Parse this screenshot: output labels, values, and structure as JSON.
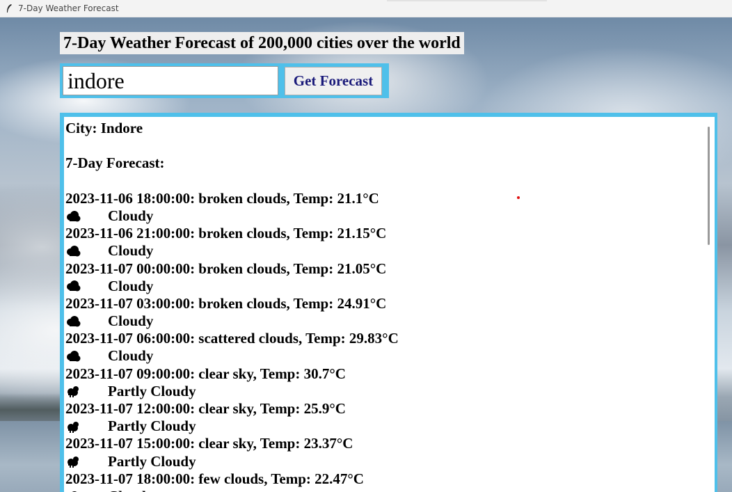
{
  "window": {
    "title": "7-Day Weather Forecast"
  },
  "heading": "7-Day Weather Forecast of 200,000 cities over the world",
  "search": {
    "value": "indore",
    "button_label": "Get Forecast"
  },
  "result": {
    "city_line": "City: Indore",
    "forecast_heading": "7-Day Forecast:",
    "entries": [
      {
        "line": "2023-11-06 18:00:00: broken clouds, Temp: 21.1°C",
        "icon": "cloud-icon",
        "condition": "Cloudy"
      },
      {
        "line": "2023-11-06 21:00:00: broken clouds, Temp: 21.15°C",
        "icon": "cloud-icon",
        "condition": "Cloudy"
      },
      {
        "line": "2023-11-07 00:00:00: broken clouds, Temp: 21.05°C",
        "icon": "cloud-icon",
        "condition": "Cloudy"
      },
      {
        "line": "2023-11-07 03:00:00: broken clouds, Temp: 24.91°C",
        "icon": "cloud-icon",
        "condition": "Cloudy"
      },
      {
        "line": "2023-11-07 06:00:00: scattered clouds, Temp: 29.83°C",
        "icon": "cloud-icon",
        "condition": "Cloudy"
      },
      {
        "line": "2023-11-07 09:00:00: clear sky, Temp: 30.7°C",
        "icon": "sun-behind-cloud-icon",
        "condition": "Partly Cloudy"
      },
      {
        "line": "2023-11-07 12:00:00: clear sky, Temp: 25.9°C",
        "icon": "sun-behind-cloud-icon",
        "condition": "Partly Cloudy"
      },
      {
        "line": "2023-11-07 15:00:00: clear sky, Temp: 23.37°C",
        "icon": "sun-behind-cloud-icon",
        "condition": "Partly Cloudy"
      },
      {
        "line": "2023-11-07 18:00:00: few clouds, Temp: 22.47°C",
        "icon": "cloud-icon",
        "condition": "Cloudy"
      }
    ]
  },
  "colors": {
    "accent_border": "#4fc0ea",
    "button_text": "#1a1a7a"
  }
}
